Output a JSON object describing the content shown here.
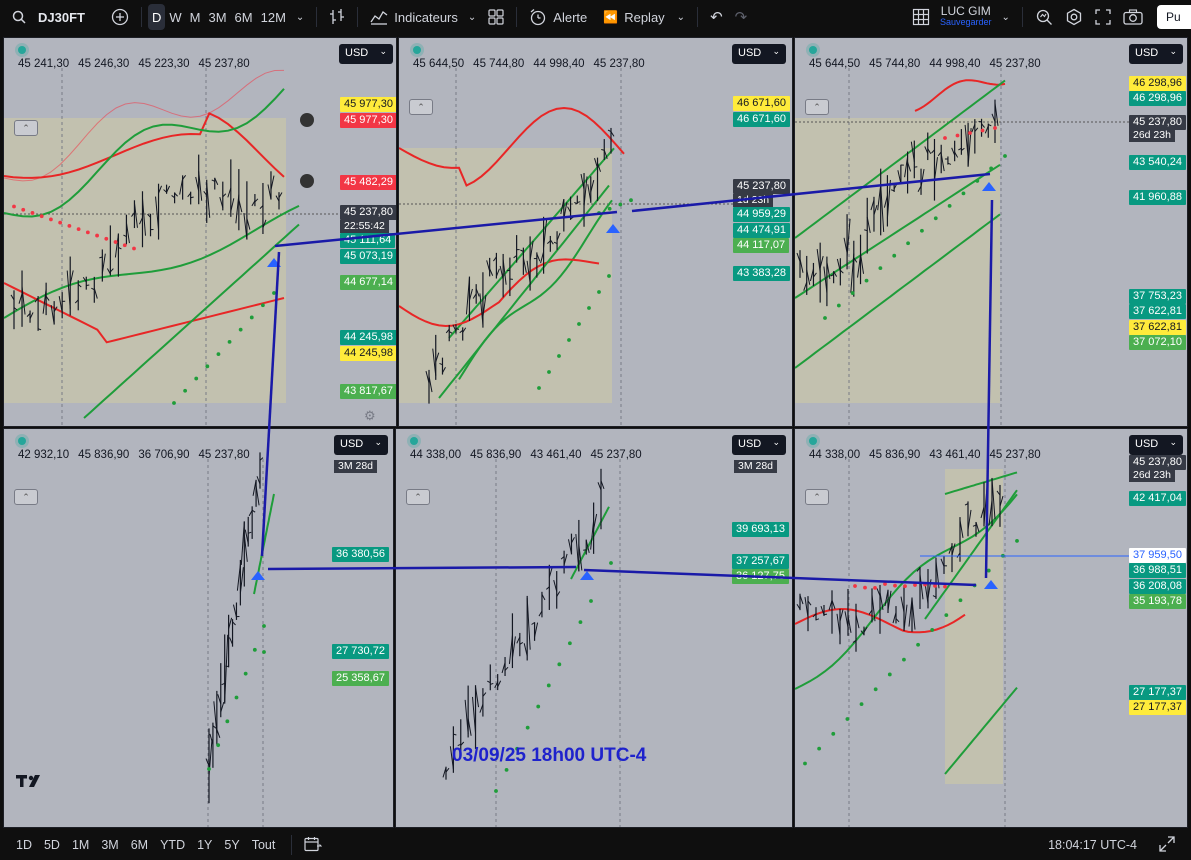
{
  "toolbar": {
    "symbol": "DJ30FT",
    "timeframes": [
      "D",
      "W",
      "M",
      "3M",
      "6M",
      "12M"
    ],
    "active_timeframe": "D",
    "indicators_label": "Indicateurs",
    "alert_label": "Alerte",
    "replay_label": "Replay",
    "account_name": "LUC GIM",
    "account_sub": "Sauvegarder",
    "publish_label": "Pu"
  },
  "currency": "USD",
  "panes": [
    {
      "ohlc": [
        "45 241,30",
        "45 246,30",
        "45 223,30",
        "45 237,80"
      ],
      "badges": [
        "45 977,30",
        "45 977,30",
        "45 482,29",
        "45 237,80",
        "45 111,64",
        "45 073,19",
        "44 677,14",
        "44 245,98",
        "44 245,98",
        "43 817,67"
      ],
      "countdown": "22:55:42"
    },
    {
      "ohlc": [
        "45 644,50",
        "45 744,80",
        "44 998,40",
        "45 237,80"
      ],
      "badges": [
        "46 671,60",
        "46 671,60",
        "45 237,80",
        "44 959,29",
        "44 474,91",
        "44 117,07",
        "43 383,28"
      ],
      "countdown": "1d 23h"
    },
    {
      "ohlc": [
        "45 644,50",
        "45 744,80",
        "44 998,40",
        "45 237,80"
      ],
      "badges": [
        "46 298,96",
        "46 298,96",
        "45 237,80",
        "43 540,24",
        "41 960,88",
        "37 753,23",
        "37 622,81",
        "37 622,81",
        "37 072,10"
      ],
      "countdown": "26d 23h"
    },
    {
      "ohlc": [
        "42 932,10",
        "45 836,90",
        "36 706,90",
        "45 237,80"
      ],
      "badges": [
        "36 380,56",
        "27 730,72",
        "25 358,67"
      ],
      "countdown": "3M 28d"
    },
    {
      "ohlc": [
        "44 338,00",
        "45 836,90",
        "43 461,40",
        "45 237,80"
      ],
      "badges": [
        "39 693,13",
        "37 257,67",
        "36 127,75"
      ],
      "countdown": "3M 28d"
    },
    {
      "ohlc": [
        "44 338,00",
        "45 836,90",
        "43 461,40",
        "45 237,80"
      ],
      "badges": [
        "45 237,80",
        "42 417,04",
        "37 959,50",
        "36 988,51",
        "36 208,08",
        "35 193,78",
        "27 177,37",
        "27 177,37"
      ],
      "countdown": "26d 23h"
    }
  ],
  "annotation": "03/09/25 18h00 UTC-4",
  "bottombar": {
    "ranges": [
      "1D",
      "5D",
      "1M",
      "3M",
      "6M",
      "YTD",
      "1Y",
      "5Y",
      "Tout"
    ],
    "clock": "18:04:17 UTC-4"
  },
  "colors": {
    "pane_bg": "#b2b5be",
    "band_fill": "#c4c3ad",
    "green_band": "#1f9d3a",
    "red_band": "#e82626",
    "trend_line": "#1a1aa8",
    "marker_blue": "#2962ff"
  }
}
